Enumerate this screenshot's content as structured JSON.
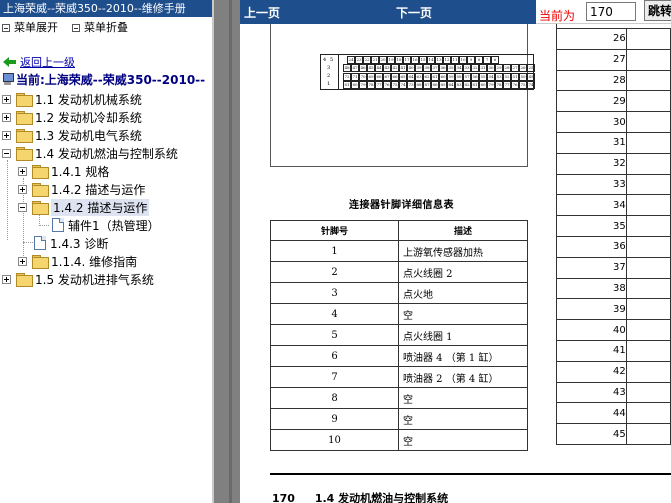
{
  "window": {
    "title": "上海荣威--荣威350--2010--维修手册"
  },
  "menu": {
    "expand": "菜单展开",
    "collapse": "菜单折叠"
  },
  "nav": {
    "back": "返回上一级",
    "current": "当前:上海荣威--荣威350--2010--"
  },
  "tree": {
    "items": [
      {
        "label": "1.1 发动机机械系统"
      },
      {
        "label": "1.2 发动机冷却系统"
      },
      {
        "label": "1.3 发动机电气系统"
      },
      {
        "label": "1.4 发动机燃油与控制系统"
      },
      {
        "label": "1.4.1 规格"
      },
      {
        "label": "1.4.2 描述与运作"
      },
      {
        "label": "1.4.2 描述与运作"
      },
      {
        "label": "辅件1（热管理）"
      },
      {
        "label": "1.4.3 诊断"
      },
      {
        "label": "1.1.4. 维修指南"
      },
      {
        "label": "1.5 发动机进排气系统"
      }
    ]
  },
  "toolbar": {
    "prev": "上一页",
    "next": "下一页",
    "page_label": "当前为",
    "page_value": "170",
    "jump": "跳转"
  },
  "document": {
    "connector": {
      "top_row": [
        "24",
        "23",
        "22",
        "21",
        "20",
        "19",
        "18",
        "17",
        "16",
        "15",
        "14",
        "13",
        "12",
        "11",
        "10",
        "9",
        "8",
        "7",
        "6"
      ],
      "upper_row": [
        "48",
        "47",
        "46",
        "45",
        "44",
        "43",
        "42",
        "41",
        "40",
        "39",
        "38",
        "37",
        "36",
        "35",
        "34",
        "33",
        "32",
        "31",
        "30",
        "29",
        "28",
        "27",
        "26",
        "25"
      ],
      "lower_row": [
        "72",
        "71",
        "70",
        "69",
        "68",
        "67",
        "66",
        "65",
        "64",
        "63",
        "62",
        "61",
        "60",
        "59",
        "58",
        "57",
        "56",
        "55",
        "54",
        "53",
        "52",
        "51",
        "50",
        "49"
      ],
      "bottom_row": [
        "81",
        "80",
        "79",
        "78",
        "77",
        "76",
        "75",
        "74",
        "73",
        "88",
        "87",
        "86",
        "85",
        "84",
        "83",
        "82",
        "81",
        "80",
        "79",
        "78",
        "77",
        "76",
        "75",
        "74"
      ],
      "side": [
        "4",
        "5",
        "3",
        "2",
        "1"
      ]
    },
    "table_title": "连接器针脚详细信息表",
    "table_headers": {
      "pin": "针脚号",
      "desc": "描述"
    },
    "pins": [
      {
        "pin": "1",
        "desc": "上游氧传感器加热"
      },
      {
        "pin": "2",
        "desc": "点火线圈 2"
      },
      {
        "pin": "3",
        "desc": "点火地"
      },
      {
        "pin": "4",
        "desc": "空"
      },
      {
        "pin": "5",
        "desc": "点火线圈 1"
      },
      {
        "pin": "6",
        "desc": "喷油器 4 （第 1 缸）"
      },
      {
        "pin": "7",
        "desc": "喷油器 2 （第 4 缸）"
      },
      {
        "pin": "8",
        "desc": "空"
      },
      {
        "pin": "9",
        "desc": "空"
      },
      {
        "pin": "10",
        "desc": "空"
      }
    ],
    "right_pins": [
      "26",
      "27",
      "28",
      "29",
      "30",
      "31",
      "32",
      "33",
      "34",
      "35",
      "36",
      "37",
      "38",
      "39",
      "40",
      "41",
      "42",
      "43",
      "44",
      "45"
    ],
    "footer": {
      "page": "170",
      "section": "1.4 发动机燃油与控制系统"
    }
  }
}
